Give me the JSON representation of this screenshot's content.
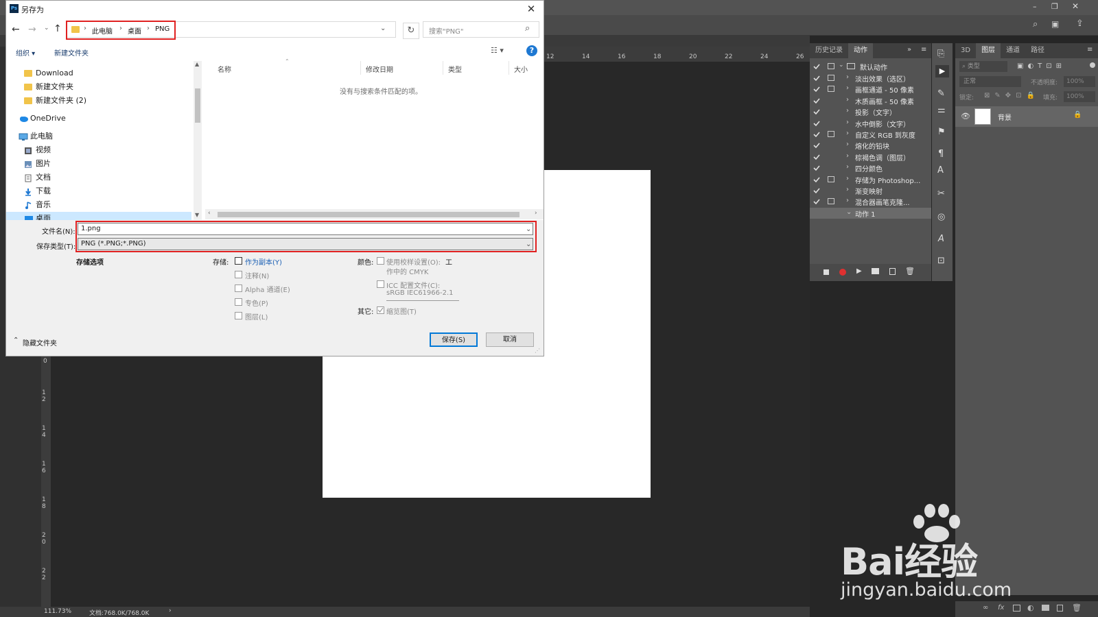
{
  "photoshop": {
    "ruler_top_ticks": [
      "12",
      "14",
      "16",
      "18",
      "20",
      "22",
      "24",
      "26"
    ],
    "ruler_left_ticks": [
      "0",
      "1 2",
      "1 4",
      "1 6",
      "1 8",
      "2 0",
      "2 2"
    ],
    "status": {
      "zoom": "111.73%",
      "doc": "文档:768.0K/768.0K",
      "arrow": "›"
    },
    "actions_panel": {
      "tabs": [
        "历史记录",
        "动作"
      ],
      "set_name": "默认动作",
      "items": [
        {
          "label": "淡出效果（选区）",
          "dialog": true
        },
        {
          "label": "画框通道 - 50 像素",
          "dialog": true
        },
        {
          "label": "木质画框 - 50 像素",
          "dialog": false
        },
        {
          "label": "投影（文字）",
          "dialog": false
        },
        {
          "label": "水中倒影（文字）",
          "dialog": false
        },
        {
          "label": "自定义 RGB 到灰度",
          "dialog": true
        },
        {
          "label": "熔化的铅块",
          "dialog": false
        },
        {
          "label": "棕褐色调（图层）",
          "dialog": false
        },
        {
          "label": "四分颜色",
          "dialog": false
        },
        {
          "label": "存储为 Photoshop...",
          "dialog": true
        },
        {
          "label": "渐变映射",
          "dialog": false
        },
        {
          "label": "混合器画笔克隆...",
          "dialog": true
        },
        {
          "label": "动作 1",
          "dialog": false
        }
      ]
    },
    "layers_panel": {
      "tabs": [
        "3D",
        "图层",
        "通道",
        "路径"
      ],
      "filter_placeholder": "类型",
      "blend_mode": "正常",
      "opacity_label": "不透明度:",
      "opacity_value": "100%",
      "lock_label": "锁定:",
      "fill_label": "填充:",
      "fill_value": "100%",
      "layer_name": "背景"
    }
  },
  "dialog": {
    "title": "另存为",
    "breadcrumb": [
      "此电脑",
      "桌面",
      "PNG"
    ],
    "search_placeholder": "搜索\"PNG\"",
    "toolbar": {
      "organize": "组织 ▾",
      "new_folder": "新建文件夹"
    },
    "nav_items": [
      {
        "label": "Download",
        "icon": "folder-icon"
      },
      {
        "label": "新建文件夹",
        "icon": "folder-icon"
      },
      {
        "label": "新建文件夹 (2)",
        "icon": "folder-icon"
      },
      {
        "label": "OneDrive",
        "icon": "cloud-icon"
      },
      {
        "label": "此电脑",
        "icon": "computer-icon"
      },
      {
        "label": "视频",
        "icon": "video-icon"
      },
      {
        "label": "图片",
        "icon": "picture-icon"
      },
      {
        "label": "文档",
        "icon": "document-icon"
      },
      {
        "label": "下载",
        "icon": "download-icon"
      },
      {
        "label": "音乐",
        "icon": "music-icon"
      },
      {
        "label": "桌面",
        "icon": "desktop-icon"
      }
    ],
    "columns": [
      "名称",
      "修改日期",
      "类型",
      "大小"
    ],
    "empty_message": "没有与搜索条件匹配的项。",
    "filename_label": "文件名(N):",
    "filename_value": "1.png",
    "filetype_label": "保存类型(T):",
    "filetype_value": "PNG (*.PNG;*.PNG)",
    "save_options_label": "存储选项",
    "save_label": "存储:",
    "save_options": [
      {
        "label": "作为副本(Y)",
        "enabled": true
      },
      {
        "label": "注释(N)",
        "enabled": false
      },
      {
        "label": "Alpha 通道(E)",
        "enabled": false
      },
      {
        "label": "专色(P)",
        "enabled": false
      },
      {
        "label": "图层(L)",
        "enabled": false
      }
    ],
    "color_label": "颜色:",
    "proof_line1": "使用校样设置(O):",
    "proof_line1b": "工",
    "proof_line2": "作中的 CMYK",
    "icc_line1": "ICC 配置文件(C):",
    "icc_line2": "sRGB IEC61966-2.1",
    "other_label": "其它:",
    "thumbnail_label": "缩览图(T)",
    "hide_folders": "隐藏文件夹",
    "save_button": "保存(S)",
    "cancel_button": "取消",
    "help_icon": "?"
  },
  "watermark": {
    "text": "Bai经验",
    "url": "jingyan.baidu.com"
  },
  "colors": {
    "highlight_red": "#e02020",
    "record_red": "#e03030",
    "accent_blue": "#0078d7"
  }
}
